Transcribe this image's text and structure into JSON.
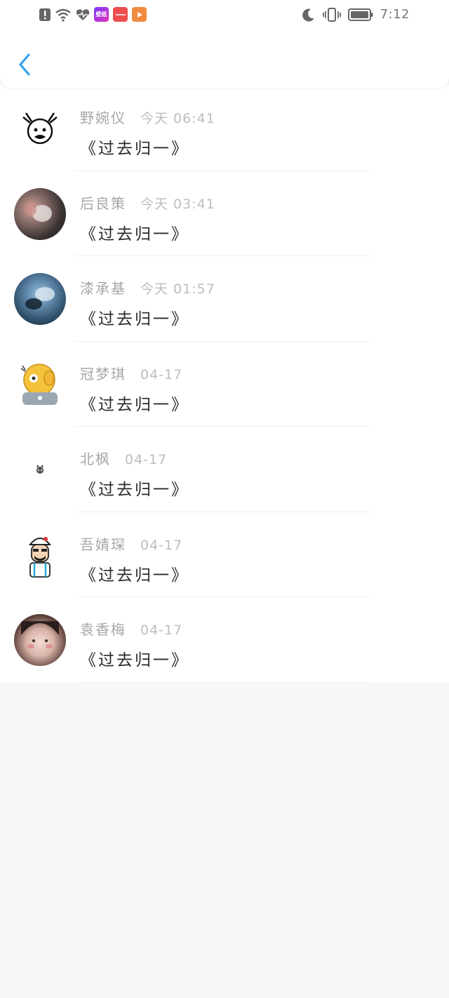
{
  "status_bar": {
    "time": "7:12",
    "icons": [
      "alert-icon",
      "wifi-icon",
      "health-icon",
      "wallpaper-app-icon",
      "red-app-icon",
      "video-app-icon",
      "moon-icon",
      "vibrate-icon",
      "battery-icon"
    ],
    "wallpaper_app_label": "壁纸"
  },
  "header": {
    "back_icon": "chevron-left-icon",
    "accent": "#2f9ff1"
  },
  "messages": [
    {
      "name": "野婉仪",
      "time": "今天 06:41",
      "text": "《过去归一》",
      "avatar": "doodle-face"
    },
    {
      "name": "后良策",
      "time": "今天 03:41",
      "text": "《过去归一》",
      "avatar": "photo-dark"
    },
    {
      "name": "漆承基",
      "time": "今天 01:57",
      "text": "《过去归一》",
      "avatar": "photo-blue"
    },
    {
      "name": "冠梦琪",
      "time": "04-17",
      "text": "《过去归一》",
      "avatar": "emoji-ear"
    },
    {
      "name": "北枫",
      "time": "04-17",
      "text": "《过去归一》",
      "avatar": "tiny-cat"
    },
    {
      "name": "吾婧琛",
      "time": "04-17",
      "text": "《过去归一》",
      "avatar": "cartoon-guy"
    },
    {
      "name": "袁香梅",
      "time": "04-17",
      "text": "《过去归一》",
      "avatar": "photo-girl"
    }
  ]
}
